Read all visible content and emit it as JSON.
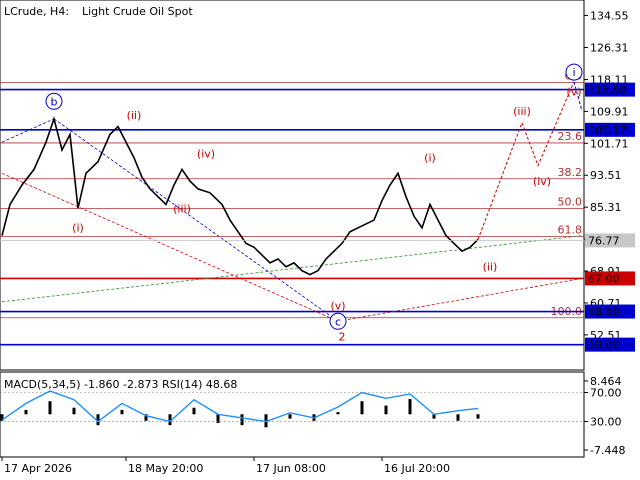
{
  "header": {
    "symbol": "LCrude, H4:",
    "name": "Light Crude Oil Spot"
  },
  "macd_header": "MACD(5,34,5) -1.860 -2.873 RSI(14) 48.68",
  "colors": {
    "red_line": "#cc0000",
    "blue_line": "#0000cc",
    "fib_line": "#b03030",
    "price_tag_bg": "#c8c8c8",
    "label_red": "#cc0000",
    "label_blue": "#0000cc",
    "rsi_line": "#1e90ff",
    "macd_hist": "#000000"
  },
  "chart_data": [
    {
      "type": "line",
      "title": "",
      "ylim": [
        44,
        138
      ],
      "y_ticks": [
        "134.55",
        "126.31",
        "118.11",
        "109.91",
        "101.71",
        "93.51",
        "85.31",
        "77.11",
        "68.91",
        "60.71",
        "52.51"
      ],
      "x_ticks": [
        "17 Apr 2026",
        "18 May 20:00",
        "17 Jun 08:00",
        "16 Jul 20:00"
      ],
      "current_price": "76.77",
      "levels": [
        {
          "value": 115.5,
          "label": "115.50",
          "color": "blue"
        },
        {
          "value": 105.17,
          "label": "105.17",
          "color": "blue"
        },
        {
          "value": 67.0,
          "label": "67.00",
          "color": "red"
        },
        {
          "value": 58.5,
          "label": "58.50",
          "color": "blue"
        },
        {
          "value": 50.0,
          "label": "50.00",
          "color": "blue"
        }
      ],
      "fibonacci": [
        {
          "value": 117.3,
          "label": "0.0"
        },
        {
          "value": 101.8,
          "label": "23.6"
        },
        {
          "value": 92.6,
          "label": "38.2"
        },
        {
          "value": 85.0,
          "label": "50.0"
        },
        {
          "value": 77.8,
          "label": "61.8"
        },
        {
          "value": 56.9,
          "label": "100.0"
        }
      ],
      "price_series": [
        {
          "x": 0,
          "y": 78
        },
        {
          "x": 2,
          "y": 86
        },
        {
          "x": 5,
          "y": 91
        },
        {
          "x": 8,
          "y": 95
        },
        {
          "x": 11,
          "y": 102
        },
        {
          "x": 13,
          "y": 108
        },
        {
          "x": 15,
          "y": 100
        },
        {
          "x": 17,
          "y": 104
        },
        {
          "x": 19,
          "y": 85
        },
        {
          "x": 21,
          "y": 94
        },
        {
          "x": 24,
          "y": 97
        },
        {
          "x": 27,
          "y": 104
        },
        {
          "x": 29,
          "y": 106
        },
        {
          "x": 31,
          "y": 102
        },
        {
          "x": 33,
          "y": 98
        },
        {
          "x": 35,
          "y": 93
        },
        {
          "x": 37,
          "y": 90
        },
        {
          "x": 39,
          "y": 88
        },
        {
          "x": 41,
          "y": 86
        },
        {
          "x": 43,
          "y": 91
        },
        {
          "x": 45,
          "y": 95
        },
        {
          "x": 47,
          "y": 92
        },
        {
          "x": 49,
          "y": 90
        },
        {
          "x": 52,
          "y": 89
        },
        {
          "x": 55,
          "y": 86
        },
        {
          "x": 57,
          "y": 82
        },
        {
          "x": 59,
          "y": 79
        },
        {
          "x": 61,
          "y": 76
        },
        {
          "x": 63,
          "y": 75
        },
        {
          "x": 65,
          "y": 73
        },
        {
          "x": 67,
          "y": 71
        },
        {
          "x": 69,
          "y": 72
        },
        {
          "x": 71,
          "y": 70
        },
        {
          "x": 73,
          "y": 71
        },
        {
          "x": 75,
          "y": 69
        },
        {
          "x": 77,
          "y": 68
        },
        {
          "x": 79,
          "y": 69
        },
        {
          "x": 81,
          "y": 72
        },
        {
          "x": 83,
          "y": 74
        },
        {
          "x": 85,
          "y": 76
        },
        {
          "x": 87,
          "y": 79
        },
        {
          "x": 89,
          "y": 80
        },
        {
          "x": 91,
          "y": 81
        },
        {
          "x": 93,
          "y": 82
        },
        {
          "x": 95,
          "y": 87
        },
        {
          "x": 97,
          "y": 91
        },
        {
          "x": 99,
          "y": 94
        },
        {
          "x": 101,
          "y": 88
        },
        {
          "x": 103,
          "y": 83
        },
        {
          "x": 105,
          "y": 80
        },
        {
          "x": 107,
          "y": 86
        },
        {
          "x": 109,
          "y": 82
        },
        {
          "x": 111,
          "y": 78
        },
        {
          "x": 113,
          "y": 76
        },
        {
          "x": 115,
          "y": 74
        },
        {
          "x": 117,
          "y": 75
        },
        {
          "x": 119,
          "y": 77
        }
      ],
      "projection": [
        {
          "x": 119,
          "y": 77
        },
        {
          "x": 130,
          "y": 107
        },
        {
          "x": 134,
          "y": 96
        },
        {
          "x": 143,
          "y": 117.5
        }
      ],
      "wave_labels": [
        {
          "text": "(i)",
          "x": 19,
          "y": 79,
          "color": "red"
        },
        {
          "text": "(ii)",
          "x": 33,
          "y": 108,
          "color": "red"
        },
        {
          "text": "(iii)",
          "x": 45,
          "y": 84,
          "color": "red"
        },
        {
          "text": "(iv)",
          "x": 51,
          "y": 98,
          "color": "red"
        },
        {
          "text": "(v)",
          "x": 84,
          "y": 59,
          "color": "red"
        },
        {
          "text": "2",
          "x": 85,
          "y": 51,
          "color": "red"
        },
        {
          "text": "(i)",
          "x": 107,
          "y": 97,
          "color": "red"
        },
        {
          "text": "(ii)",
          "x": 122,
          "y": 69,
          "color": "red"
        },
        {
          "text": "(iii)",
          "x": 130,
          "y": 109,
          "color": "red"
        },
        {
          "text": "(iv)",
          "x": 135,
          "y": 91,
          "color": "red"
        },
        {
          "text": "(v)",
          "x": 143,
          "y": 114,
          "color": "red"
        }
      ],
      "circle_labels": [
        {
          "text": "b",
          "x": 13,
          "y": 112.5
        },
        {
          "text": "c",
          "x": 84,
          "y": 56
        },
        {
          "text": "i",
          "x": 143,
          "y": 120
        }
      ]
    },
    {
      "type": "line",
      "title": "MACD(5,34,5) / RSI(14)",
      "ylim": [
        -12,
        90
      ],
      "y_ticks": [
        "8.464",
        "70.00",
        "30.00",
        "-7.448"
      ],
      "rsi_series": [
        {
          "x": 0,
          "y": 32
        },
        {
          "x": 6,
          "y": 55
        },
        {
          "x": 12,
          "y": 72
        },
        {
          "x": 18,
          "y": 60
        },
        {
          "x": 24,
          "y": 30
        },
        {
          "x": 30,
          "y": 55
        },
        {
          "x": 36,
          "y": 38
        },
        {
          "x": 42,
          "y": 30
        },
        {
          "x": 48,
          "y": 60
        },
        {
          "x": 54,
          "y": 40
        },
        {
          "x": 60,
          "y": 35
        },
        {
          "x": 66,
          "y": 30
        },
        {
          "x": 72,
          "y": 42
        },
        {
          "x": 78,
          "y": 35
        },
        {
          "x": 84,
          "y": 50
        },
        {
          "x": 90,
          "y": 70
        },
        {
          "x": 96,
          "y": 62
        },
        {
          "x": 102,
          "y": 68
        },
        {
          "x": 108,
          "y": 40
        },
        {
          "x": 114,
          "y": 45
        },
        {
          "x": 119,
          "y": 48
        }
      ],
      "macd_hist": [
        {
          "x": 0,
          "y": -3
        },
        {
          "x": 6,
          "y": 2
        },
        {
          "x": 12,
          "y": 6
        },
        {
          "x": 18,
          "y": 3
        },
        {
          "x": 24,
          "y": -5
        },
        {
          "x": 30,
          "y": 2
        },
        {
          "x": 36,
          "y": -3
        },
        {
          "x": 42,
          "y": -5
        },
        {
          "x": 48,
          "y": 3
        },
        {
          "x": 54,
          "y": -4
        },
        {
          "x": 60,
          "y": -5
        },
        {
          "x": 66,
          "y": -6
        },
        {
          "x": 72,
          "y": -2
        },
        {
          "x": 78,
          "y": -3
        },
        {
          "x": 84,
          "y": 1
        },
        {
          "x": 90,
          "y": 6
        },
        {
          "x": 96,
          "y": 4
        },
        {
          "x": 102,
          "y": 7
        },
        {
          "x": 108,
          "y": -2
        },
        {
          "x": 114,
          "y": -3
        },
        {
          "x": 119,
          "y": -2
        }
      ]
    }
  ]
}
